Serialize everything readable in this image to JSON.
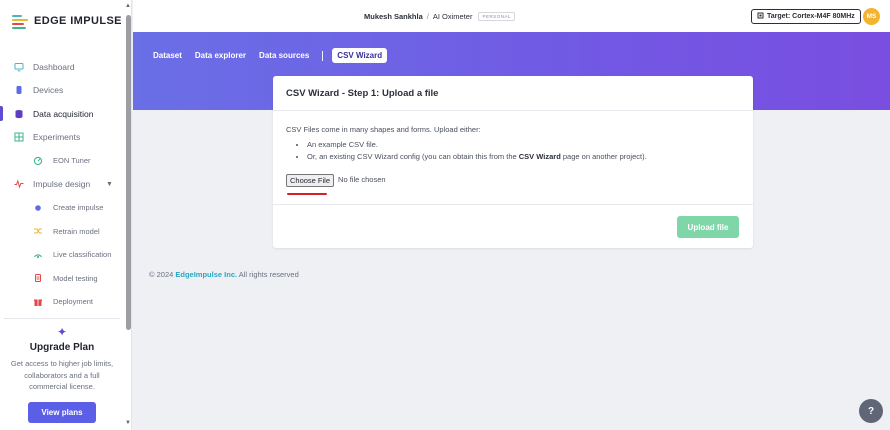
{
  "brand": {
    "name": "EDGE IMPULSE"
  },
  "sidebar": {
    "items": [
      {
        "label": "Dashboard",
        "icon": "monitor-icon",
        "color": "#4fb3c8"
      },
      {
        "label": "Devices",
        "icon": "device-icon",
        "color": "#5b6ee6"
      },
      {
        "label": "Data acquisition",
        "icon": "database-icon",
        "color": "#5b3ec4"
      },
      {
        "label": "Experiments",
        "icon": "grid-icon",
        "color": "#3fb58a"
      },
      {
        "label": "EON Tuner",
        "icon": "tuner-icon",
        "color": "#3fb58a"
      },
      {
        "label": "Impulse design",
        "icon": "pulse-icon",
        "color": "#e04a4a"
      },
      {
        "label": "Create impulse",
        "icon": "dot-icon",
        "color": "#5b6ee6"
      },
      {
        "label": "Retrain model",
        "icon": "shuffle-icon",
        "color": "#f0b429"
      },
      {
        "label": "Live classification",
        "icon": "live-icon",
        "color": "#3fb58a"
      },
      {
        "label": "Model testing",
        "icon": "flask-icon",
        "color": "#e04a4a"
      },
      {
        "label": "Deployment",
        "icon": "gift-icon",
        "color": "#e04a4a"
      }
    ],
    "upgrade": {
      "title": "Upgrade Plan",
      "text": "Get access to higher job limits, collaborators and a full commercial license.",
      "button": "View plans"
    }
  },
  "topbar": {
    "user": "Mukesh Sankhla",
    "separator": "/",
    "project": "AI Oximeter",
    "badge": "PERSONAL",
    "target": "Target: Cortex-M4F 80MHz",
    "avatar": "MS"
  },
  "tabs": [
    {
      "label": "Dataset"
    },
    {
      "label": "Data explorer"
    },
    {
      "label": "Data sources"
    },
    {
      "label": "CSV Wizard"
    }
  ],
  "card": {
    "title": "CSV Wizard - Step 1: Upload a file",
    "intro": "CSV Files come in many shapes and forms. Upload either:",
    "bullet1": "An example CSV file.",
    "bullet2_pre": "Or, an existing CSV Wizard config (you can obtain this from the ",
    "bullet2_bold": "CSV Wizard",
    "bullet2_post": " page on another project).",
    "choose_label": "Choose File",
    "no_file": "No file chosen",
    "upload_label": "Upload file"
  },
  "footer": {
    "prefix": "© 2024 ",
    "link": "EdgeImpulse Inc.",
    "suffix": " All rights reserved"
  },
  "colors": {
    "accent": "#5b5ee6",
    "upload": "#7fd6a9",
    "link": "#2aa6c4"
  }
}
